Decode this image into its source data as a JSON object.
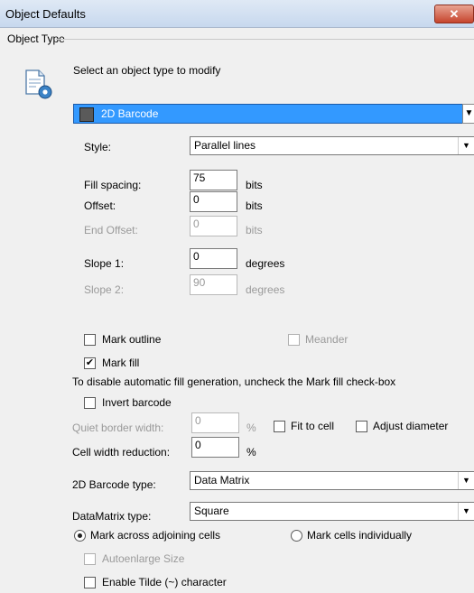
{
  "window": {
    "title": "Object Defaults",
    "close_glyph": "✕"
  },
  "group": {
    "label": "Object Type",
    "instruction": "Select an object type to modify",
    "icon": "document-gear-icon",
    "object_type": "2D Barcode",
    "object_type_icon": "barcode-icon"
  },
  "style": {
    "label": "Style:",
    "value": "Parallel lines"
  },
  "fill_spacing": {
    "label": "Fill spacing:",
    "value": "75",
    "unit": "bits"
  },
  "offset": {
    "label": "Offset:",
    "value": "0",
    "unit": "bits"
  },
  "end_offset": {
    "label": "End Offset:",
    "value": "0",
    "unit": "bits"
  },
  "slope1": {
    "label": "Slope 1:",
    "value": "0",
    "unit": "degrees"
  },
  "slope2": {
    "label": "Slope 2:",
    "value": "90",
    "unit": "degrees"
  },
  "mark_outline": {
    "label": "Mark outline",
    "checked": false
  },
  "meander": {
    "label": "Meander",
    "checked": false
  },
  "mark_fill": {
    "label": "Mark fill",
    "checked": true,
    "check_glyph": "✔"
  },
  "fill_note": "To disable automatic fill generation, uncheck the Mark fill check-box",
  "invert_barcode": {
    "label": "Invert barcode",
    "checked": false
  },
  "quiet_border": {
    "label": "Quiet border width:",
    "value": "0",
    "unit": "%"
  },
  "fit_to_cell": {
    "label": "Fit to cell",
    "checked": false
  },
  "adjust_diameter": {
    "label": "Adjust diameter",
    "checked": false
  },
  "cell_width_reduction": {
    "label": "Cell width reduction:",
    "value": "0",
    "unit": "%"
  },
  "barcode_type": {
    "label": "2D Barcode type:",
    "value": "Data Matrix"
  },
  "datamatrix_type": {
    "label": "DataMatrix type:",
    "value": "Square"
  },
  "mark_across": {
    "label": "Mark across adjoining cells",
    "selected": true
  },
  "mark_individually": {
    "label": "Mark cells individually",
    "selected": false
  },
  "autoenlarge": {
    "label": "Autoenlarge Size",
    "checked": false
  },
  "enable_tilde": {
    "label": "Enable Tilde (~) character",
    "checked": false
  },
  "dropdown_glyph": "▼"
}
